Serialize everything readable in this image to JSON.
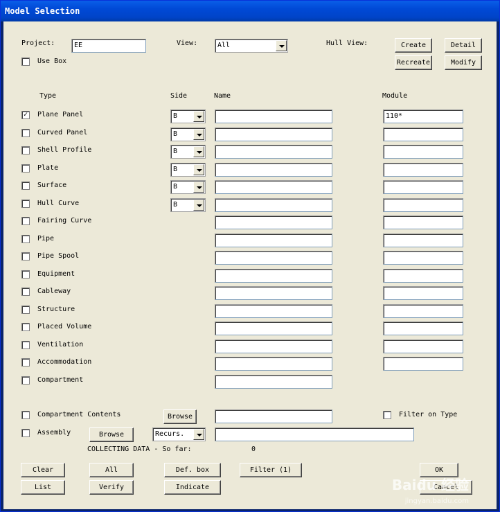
{
  "window": {
    "title": "Model Selection"
  },
  "project": {
    "label": "Project:",
    "value": "EE"
  },
  "use_box": {
    "label": "Use Box",
    "checked": false
  },
  "view": {
    "label": "View:",
    "value": "All"
  },
  "hull_view": {
    "label": "Hull View:",
    "buttons": [
      "Create",
      "Detail",
      "Recreate",
      "Modify"
    ]
  },
  "headers": {
    "type": "Type",
    "side": "Side",
    "name": "Name",
    "module": "Module"
  },
  "types": [
    {
      "label": "Plane Panel",
      "checked": true,
      "side": "B",
      "name": "",
      "module": "110*"
    },
    {
      "label": "Curved Panel",
      "checked": false,
      "side": "B",
      "name": "",
      "module": ""
    },
    {
      "label": "Shell Profile",
      "checked": false,
      "side": "B",
      "name": "",
      "module": ""
    },
    {
      "label": "Plate",
      "checked": false,
      "side": "B",
      "name": "",
      "module": ""
    },
    {
      "label": "Surface",
      "checked": false,
      "side": "B",
      "name": "",
      "module": ""
    },
    {
      "label": "Hull Curve",
      "checked": false,
      "side": "B",
      "name": "",
      "module": ""
    },
    {
      "label": "Fairing Curve",
      "checked": false,
      "name": "",
      "module": ""
    },
    {
      "label": "Pipe",
      "checked": false,
      "name": "",
      "module": ""
    },
    {
      "label": "Pipe Spool",
      "checked": false,
      "name": "",
      "module": ""
    },
    {
      "label": "Equipment",
      "checked": false,
      "name": "",
      "module": ""
    },
    {
      "label": "Cableway",
      "checked": false,
      "name": "",
      "module": ""
    },
    {
      "label": "Structure",
      "checked": false,
      "name": "",
      "module": ""
    },
    {
      "label": "Placed Volume",
      "checked": false,
      "name": "",
      "module": ""
    },
    {
      "label": "Ventilation",
      "checked": false,
      "name": "",
      "module": ""
    },
    {
      "label": "Accommodation",
      "checked": false,
      "name": "",
      "module": ""
    },
    {
      "label": "Compartment",
      "checked": false,
      "name": ""
    }
  ],
  "compartment_contents": {
    "label": "Compartment Contents",
    "browse": "Browse",
    "value": ""
  },
  "filter_on_type": {
    "label": "Filter on Type",
    "checked": false
  },
  "assembly": {
    "label": "Assembly",
    "browse": "Browse",
    "recurs": "Recurs.",
    "value": ""
  },
  "status": {
    "text": "COLLECTING DATA - So far:",
    "count": "0"
  },
  "bottom_buttons": {
    "clear": "Clear",
    "all": "All",
    "def_box": "Def. box",
    "filter": "Filter (1)",
    "ok": "OK",
    "list": "List",
    "verify": "Verify",
    "indicate": "Indicate",
    "cancel": "Cancel"
  },
  "watermark": {
    "brand": "Baidu 经验",
    "url": "jingyan.baidu.com"
  }
}
